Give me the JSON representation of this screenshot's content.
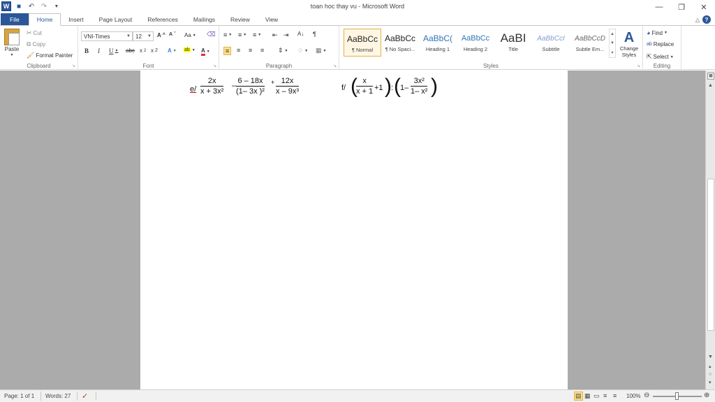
{
  "window": {
    "title": "toan hoc thay vu  -  Microsoft Word",
    "qat_logo": "W"
  },
  "tabs": [
    "File",
    "Home",
    "Insert",
    "Page Layout",
    "References",
    "Mailings",
    "Review",
    "View"
  ],
  "clipboard": {
    "paste": "Paste",
    "cut": "Cut",
    "copy": "Copy",
    "format_painter": "Format Painter",
    "label": "Clipboard"
  },
  "font": {
    "name": "VNI-Times",
    "size": "12",
    "label": "Font"
  },
  "paragraph": {
    "label": "Paragraph"
  },
  "styles": {
    "label": "Styles",
    "change_styles": "Change Styles",
    "items": [
      {
        "preview": "AaBbCc",
        "name": "¶ Normal"
      },
      {
        "preview": "AaBbCc",
        "name": "¶ No Spaci..."
      },
      {
        "preview": "AaBbC(",
        "name": "Heading 1"
      },
      {
        "preview": "AaBbCc",
        "name": "Heading 2"
      },
      {
        "preview": "AaBI",
        "name": "Title"
      },
      {
        "preview": "AaBbCcI",
        "name": "Subtitle"
      },
      {
        "preview": "AaBbCcD",
        "name": "Subtle Em..."
      }
    ]
  },
  "editing": {
    "find": "Find",
    "replace": "Replace",
    "select": "Select",
    "label": "Editing"
  },
  "document": {
    "label_e": "e/",
    "label_f": "f/",
    "e_terms": [
      {
        "num": "2x",
        "den": "x + 3x²"
      },
      {
        "num": "6 – 18x",
        "den": "(1– 3x )²"
      },
      {
        "num": "12x",
        "den": "x – 9x³"
      }
    ],
    "e_ops": [
      "–",
      "+"
    ],
    "f_term1": {
      "num": "x",
      "den": "x + 1"
    },
    "f_plus_one": "+1",
    "f_colon": ":",
    "f_one_minus": "1–",
    "f_term2": {
      "num": "3x²",
      "den": "1– x²"
    }
  },
  "status": {
    "page": "Page: 1 of 1",
    "words": "Words: 27",
    "zoom": "100%"
  },
  "colors": {
    "accent": "#2b579a",
    "doc_background": "#ababab"
  }
}
